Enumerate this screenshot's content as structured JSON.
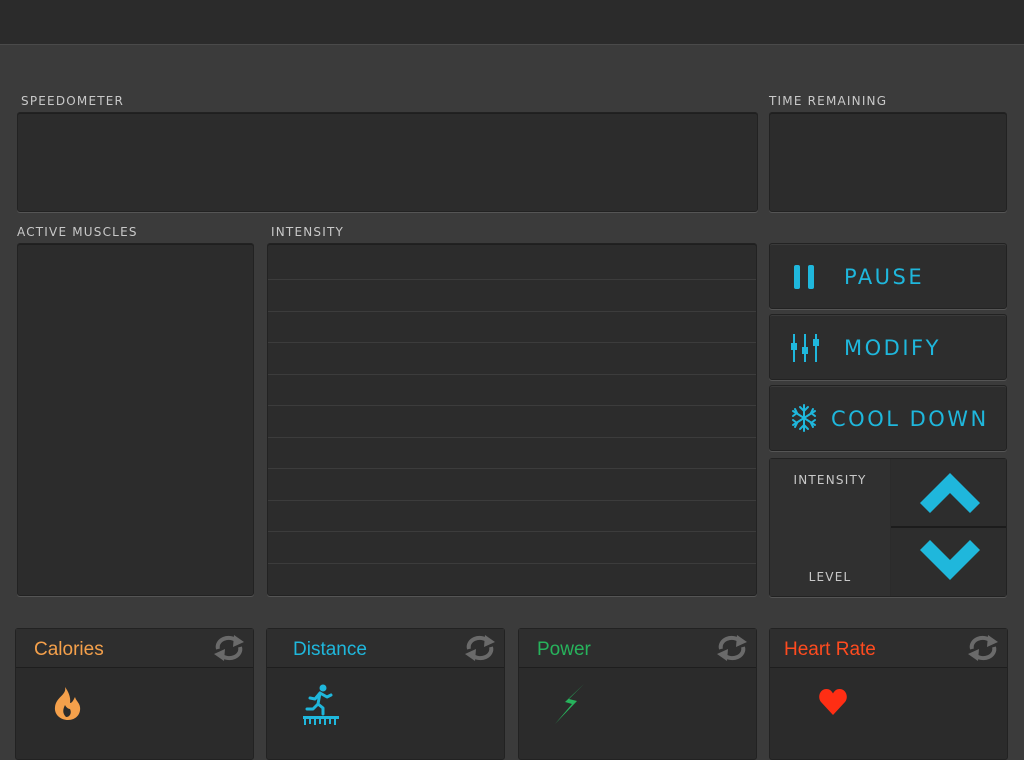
{
  "labels": {
    "speedometer": "SPEEDOMETER",
    "time_remaining": "TIME REMAINING",
    "active_muscles": "ACTIVE MUSCLES",
    "intensity": "INTENSITY"
  },
  "controls": {
    "pause": "PAUSE",
    "modify": "MODIFY",
    "cool_down": "COOL DOWN",
    "intensity_level_top": "INTENSITY",
    "intensity_level_bottom": "LEVEL"
  },
  "stats": {
    "calories": "Calories",
    "distance": "Distance",
    "power": "Power",
    "heart_rate": "Heart Rate"
  },
  "colors": {
    "accent": "#1fb7dc",
    "calories": "#f4a04b",
    "distance": "#1fb7dc",
    "power": "#27b35c",
    "heart_rate": "#ff4b1f"
  },
  "icons": {
    "pause": "pause-icon",
    "modify": "sliders-icon",
    "cool_down": "snowflake-icon",
    "up": "chevron-up-icon",
    "down": "chevron-down-icon",
    "refresh": "refresh-icon",
    "calories": "flame-icon",
    "distance": "runner-icon",
    "power": "lightning-icon",
    "heart_rate": "heart-icon"
  }
}
